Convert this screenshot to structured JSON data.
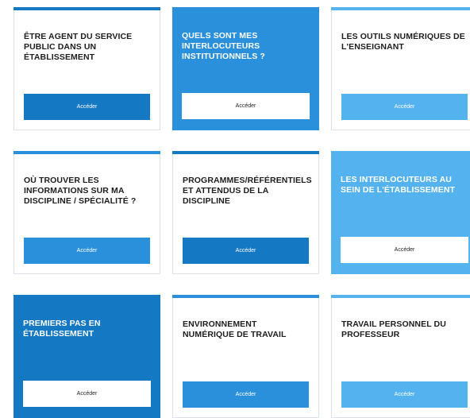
{
  "colors": {
    "dark_blue": "#1578c2",
    "mid_blue": "#2a90dc",
    "light_blue": "#54b2ee",
    "white": "#ffffff"
  },
  "cards": [
    {
      "title": "ÊTRE AGENT DU SERVICE PUBLIC DANS UN ÉTABLISSEMENT",
      "button_label": "Accéder",
      "style": "white",
      "accent": "#1578c2"
    },
    {
      "title": "QUELS SONT MES INTERLOCUTEURS INSTITUTIONNELS ?",
      "button_label": "Accéder",
      "style": "filled",
      "accent": "#2a90dc"
    },
    {
      "title": "LES OUTILS NUMÉRIQUES DE L'ENSEIGNANT",
      "button_label": "Accéder",
      "style": "white",
      "accent": "#54b2ee"
    },
    {
      "title": "OÙ TROUVER LES INFORMATIONS SUR MA DISCIPLINE / SPÉCIALITÉ ?",
      "button_label": "Accéder",
      "style": "white",
      "accent": "#2a90dc"
    },
    {
      "title": "PROGRAMMES/RÉFÉRENTIELS ET ATTENDUS DE LA DISCIPLINE",
      "button_label": "Accéder",
      "style": "white",
      "accent": "#1578c2"
    },
    {
      "title": "LES INTERLOCUTEURS AU SEIN DE L'ÉTABLISSEMENT",
      "button_label": "Accéder",
      "style": "filled",
      "accent": "#54b2ee"
    },
    {
      "title": "PREMIERS PAS EN ÉTABLISSEMENT",
      "button_label": "Accéder",
      "style": "filled",
      "accent": "#1578c2"
    },
    {
      "title": "ENVIRONNEMENT NUMÉRIQUE DE TRAVAIL",
      "button_label": "Accéder",
      "style": "white",
      "accent": "#2a90dc"
    },
    {
      "title": "TRAVAIL PERSONNEL DU PROFESSEUR",
      "button_label": "Accéder",
      "style": "white",
      "accent": "#54b2ee"
    }
  ]
}
